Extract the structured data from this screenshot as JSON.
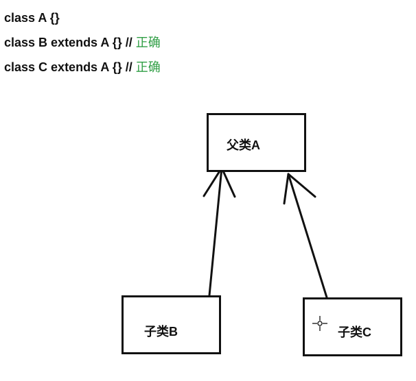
{
  "code": {
    "lines": [
      {
        "code": "class A {}",
        "comment": ""
      },
      {
        "code": "class B extends A {} // ",
        "comment": "正确"
      },
      {
        "code": "class C extends A {} // ",
        "comment": "正确"
      }
    ]
  },
  "diagram": {
    "parent_label": "父类A",
    "child_b_label": "子类B",
    "child_c_label": "子类C"
  },
  "colors": {
    "text": "#111111",
    "correct_comment": "#2f9e44",
    "background": "#ffffff"
  },
  "icons": {
    "cursor": "crosshair-cursor-icon"
  }
}
